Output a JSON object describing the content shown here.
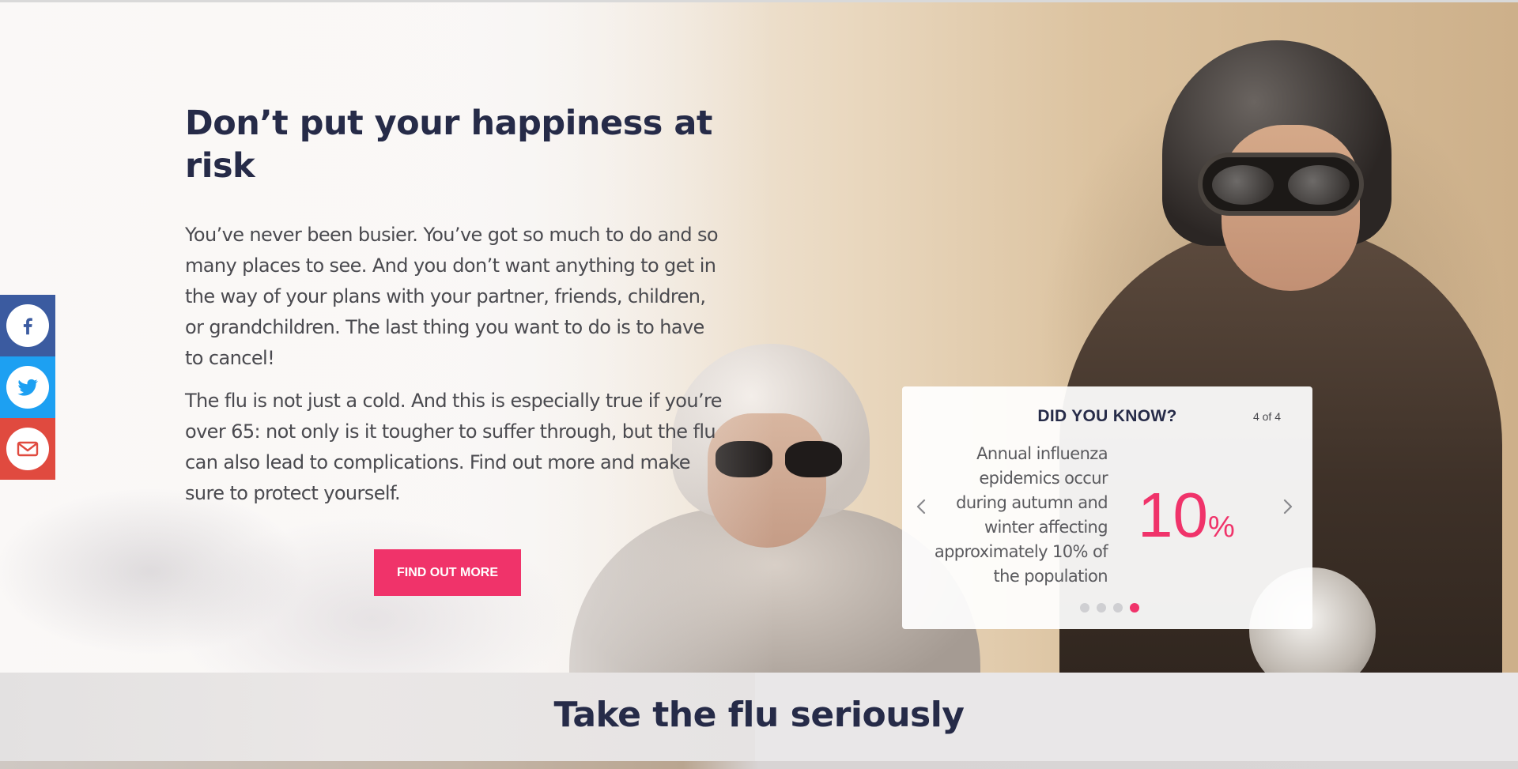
{
  "hero": {
    "title": "Don’t put your happiness at risk",
    "paragraph1": "You’ve never been busier. You’ve got so much to do and so many places to see. And you don’t want anything to get in the way of your plans with your partner, friends, children, or grandchildren. The last thing you want to do is to have to cancel!",
    "paragraph2": "The flu is not just a cold. And this is especially true if you’re over 65: not only is it tougher to suffer through, but the flu can also lead to complications. Find out more and make sure to protect yourself.",
    "cta_label": "FIND OUT MORE"
  },
  "share": {
    "items": [
      {
        "name": "facebook",
        "icon": "facebook-icon",
        "color": "#3b5ba0"
      },
      {
        "name": "twitter",
        "icon": "twitter-icon",
        "color": "#1da0f2"
      },
      {
        "name": "email",
        "icon": "mail-icon",
        "color": "#e04a3f"
      }
    ]
  },
  "did_you_know": {
    "title": "DID YOU KNOW?",
    "counter": "4 of 4",
    "text": "Annual influenza epidemics occur during autumn and winter affecting approximately 10% of the population",
    "stat_number": "10",
    "stat_unit": "%",
    "slides_total": 4,
    "active_slide": 4
  },
  "section2": {
    "title": "Take the flu seriously"
  },
  "colors": {
    "accent": "#f0336a",
    "heading": "#262b48",
    "body_text": "#4a4a4f"
  }
}
